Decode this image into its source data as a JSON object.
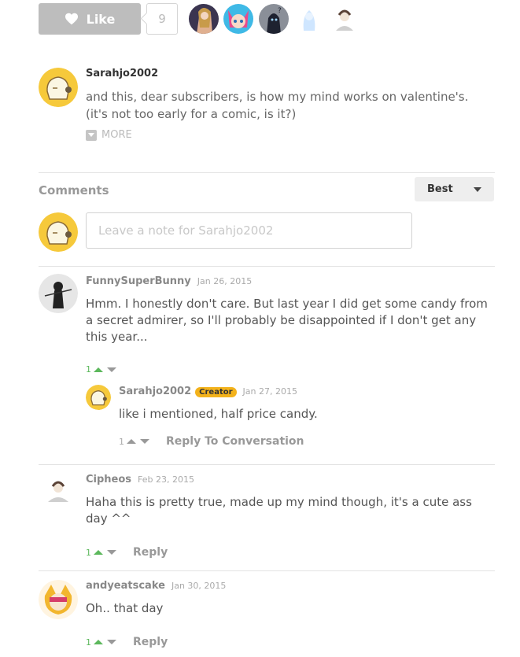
{
  "like_bar": {
    "like_label": "Like",
    "like_count": "9",
    "likers": [
      "liker-avatar-1",
      "liker-avatar-2",
      "liker-avatar-3",
      "liker-avatar-4",
      "liker-avatar-5"
    ]
  },
  "post": {
    "author": "Sarahjo2002",
    "description": "and this, dear subscribers, is how my mind works on valentine's. (it's not too early for a comic, is it?)",
    "more_label": "MORE"
  },
  "comments_header": {
    "title": "Comments",
    "sort_selected": "Best"
  },
  "new_comment": {
    "placeholder": "Leave a note for Sarahjo2002"
  },
  "comments": [
    {
      "author": "FunnySuperBunny",
      "date": "Jan 26, 2015",
      "text": "Hmm. I honestly don't care. But last year I did get some candy from a secret admirer, so I'll probably be disappointed if I don't get any this year...",
      "votes": "1",
      "replies": [
        {
          "author": "Sarahjo2002",
          "badge": "Creator",
          "date": "Jan 27, 2015",
          "text": "like i mentioned, half price candy.",
          "votes": "1",
          "reply_label": "Reply To Conversation"
        }
      ]
    },
    {
      "author": "Cipheos",
      "date": "Feb 23, 2015",
      "text": "Haha this is pretty true, made up my mind though, it's a cute ass day ^^",
      "votes": "1",
      "reply_label": "Reply"
    },
    {
      "author": "andyeatscake",
      "date": "Jan 30, 2015",
      "text": "Oh.. that day",
      "votes": "1",
      "reply_label": "Reply"
    }
  ],
  "colors": {
    "upvote_green": "#5cb85c",
    "creator_badge": "#f3b21b",
    "like_button": "#bdbdbd"
  }
}
